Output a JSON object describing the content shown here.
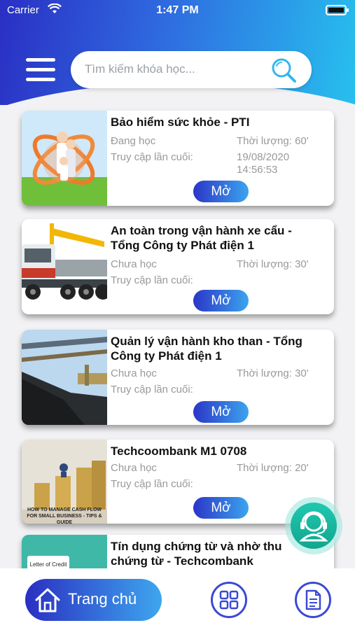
{
  "status_bar": {
    "carrier": "Carrier",
    "time": "1:47 PM"
  },
  "search": {
    "placeholder": "Tìm kiếm khóa học..."
  },
  "courses": [
    {
      "title": "Bảo hiểm sức khỏe - PTI",
      "status": "Đang học",
      "duration": "Thời lượng: 60'",
      "last_access_label": "Truy cập lần cuối:",
      "last_access_date": "19/08/2020",
      "last_access_time": "14:56:53",
      "button": "Mở"
    },
    {
      "title": "An toàn trong vận hành xe cẩu - Tổng Công ty Phát điện 1",
      "status": "Chưa học",
      "duration": "Thời lượng: 30'",
      "last_access_label": "Truy cập lần cuối:",
      "button": "Mở"
    },
    {
      "title": "Quản lý vận hành kho than - Tổng Công ty Phát điện 1",
      "status": "Chưa học",
      "duration": "Thời lượng: 30'",
      "last_access_label": "Truy cập lần cuối:",
      "button": "Mở"
    },
    {
      "title": "Techcoombank M1 0708",
      "status": "Chưa học",
      "duration": "Thời lượng: 20'",
      "last_access_label": "Truy cập lần cuối:",
      "button": "Mở",
      "thumb_caption": "HOW TO MANAGE CASH FLOW FOR SMALL BUSINESS - TIPS & GUIDE"
    },
    {
      "title": "Tín dụng chứng từ và nhờ thu chứng từ - Techcombank",
      "thumb_caption": "Letter of Credit"
    }
  ],
  "nav": {
    "home_label": "Trang chủ"
  },
  "colors": {
    "accent_dark": "#2a2fc4",
    "accent_light": "#27c0ee",
    "support": "#14b39b"
  }
}
